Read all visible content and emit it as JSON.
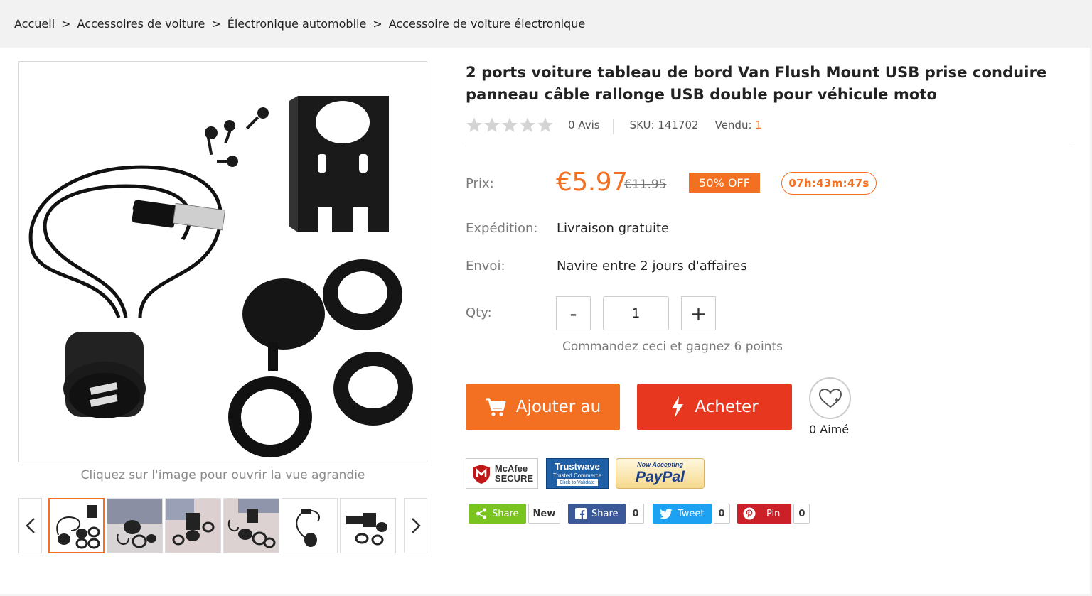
{
  "breadcrumb": {
    "items": [
      "Accueil",
      "Accessoires de voiture",
      "Électronique automobile",
      "Accessoire de voiture électronique"
    ],
    "separator": ">"
  },
  "gallery": {
    "zoom_hint": "Cliquez sur l'image pour ouvrir la vue agrandie",
    "thumbnail_count": 6,
    "active_index": 0
  },
  "product": {
    "title": "2 ports voiture tableau de bord Van Flush Mount USB prise conduire panneau câble rallonge USB double pour véhicule moto",
    "rating_stars": 0,
    "reviews": "0 Avis",
    "sku": "SKU: 141702",
    "sold_label": "Vendu:",
    "sold_count": "1",
    "price_label": "Prix:",
    "price": "€5.97",
    "old_price": "€11.95",
    "discount": "50% OFF",
    "countdown": "07h:43m:47s",
    "shipping_label": "Expédition:",
    "shipping_value": "Livraison gratuite",
    "dispatch_label": "Envoi:",
    "dispatch_value": "Navire entre 2 jours d'affaires",
    "qty_label": "Qty:",
    "qty_minus": "-",
    "qty_plus": "+",
    "qty_value": "1",
    "points_text": "Commandez ceci et gagnez 6 points",
    "add_to_cart": "Ajouter au",
    "buy_now": "Acheter",
    "likes": "0 Aimé"
  },
  "trust_badges": {
    "mcafee_line1": "McAfee",
    "mcafee_line2": "SECURE",
    "trustwave_line1": "Trustwave",
    "trustwave_line2": "Trusted Commerce",
    "trustwave_line3": "Click to Validate",
    "paypal_line1": "Now Accepting",
    "paypal_line2": "PayPal"
  },
  "social": [
    {
      "label": "Share",
      "count": "New",
      "color": "#7ac41f",
      "icon": "share-icon"
    },
    {
      "label": "Share",
      "count": "0",
      "color": "#3b5998",
      "icon": "facebook-icon"
    },
    {
      "label": "Tweet",
      "count": "0",
      "color": "#1da1f2",
      "icon": "twitter-icon"
    },
    {
      "label": "Pin",
      "count": "0",
      "color": "#cb2027",
      "icon": "pinterest-icon"
    }
  ],
  "colors": {
    "accent": "#f36f21",
    "buy": "#e8371f"
  }
}
